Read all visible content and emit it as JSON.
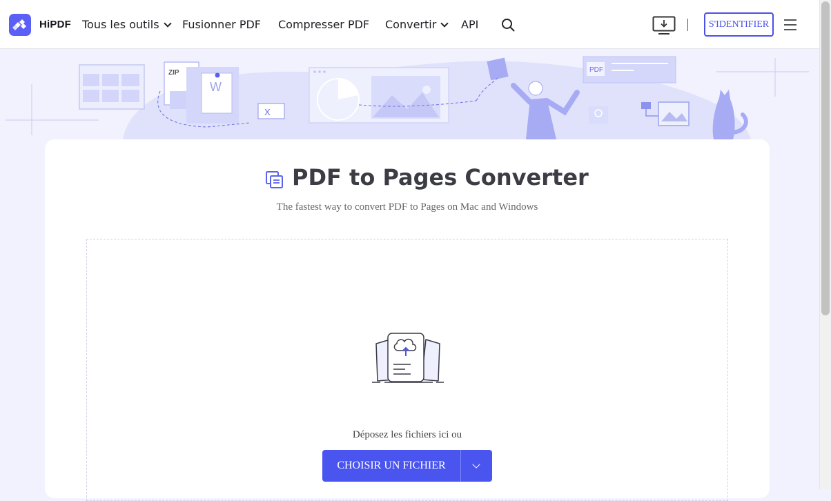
{
  "header": {
    "brand": "HiPDF",
    "nav": [
      {
        "label": "Tous les outils",
        "has_dropdown": true
      },
      {
        "label": "Fusionner PDF",
        "has_dropdown": false
      },
      {
        "label": "Compresser PDF",
        "has_dropdown": false
      },
      {
        "label": "Convertir",
        "has_dropdown": true
      },
      {
        "label": "API",
        "has_dropdown": false
      }
    ],
    "signin_label": "S'IDENTIFIER",
    "icons": [
      "logo-icon",
      "search-icon",
      "download-app-icon",
      "hamburger-menu-icon"
    ]
  },
  "hero": {
    "illustration_labels": {
      "zip": "ZIP",
      "pdf": "PDF",
      "word": "W",
      "excel": "X"
    }
  },
  "main": {
    "title": "PDF to Pages Converter",
    "subtitle": "The fastest way to convert PDF to Pages on Mac and Windows",
    "drop_text": "Déposez les fichiers ici ou",
    "choose_button": "CHOISIR UN FICHIER"
  },
  "colors": {
    "accent": "#4a55f0",
    "page_background": "#f1f2fd",
    "title_text": "#3c3c44"
  }
}
